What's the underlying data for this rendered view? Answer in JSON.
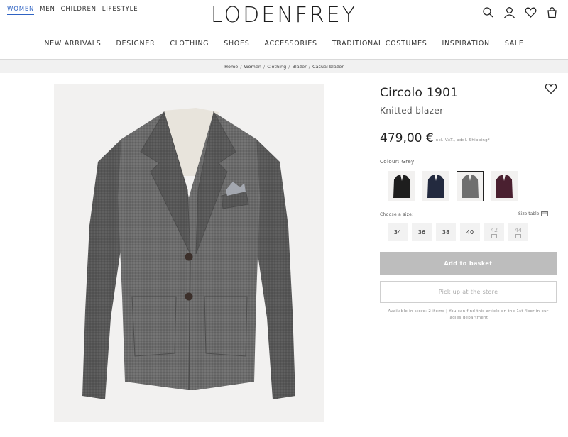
{
  "header": {
    "logo": "LODENFREY",
    "top_links": [
      "WOMEN",
      "MEN",
      "CHILDREN",
      "LIFESTYLE"
    ],
    "active_top_link": "WOMEN",
    "icons": [
      "search-icon",
      "account-icon",
      "wishlist-icon",
      "basket-icon"
    ]
  },
  "main_nav": [
    "NEW ARRIVALS",
    "DESIGNER",
    "CLOTHING",
    "SHOES",
    "ACCESSORIES",
    "TRADITIONAL COSTUMES",
    "INSPIRATION",
    "SALE"
  ],
  "breadcrumb": [
    "Home",
    "Women",
    "Clothing",
    "Blazer",
    "Casual blazer"
  ],
  "product": {
    "brand": "Circolo 1901",
    "name": "Knitted blazer",
    "price": "479,00 €",
    "price_note": "incl. VAT., addl. Shipping*",
    "colour_label": "Colour: Grey",
    "colour_swatches": [
      {
        "name": "black",
        "color": "#1e1e1e",
        "selected": false
      },
      {
        "name": "navy",
        "color": "#232a3f",
        "selected": false
      },
      {
        "name": "grey",
        "color": "#6f6f6f",
        "selected": true
      },
      {
        "name": "burgundy",
        "color": "#4a2030",
        "selected": false
      }
    ],
    "size_label": "Choose a size:",
    "size_table_label": "Size table",
    "sizes": [
      {
        "label": "34",
        "available": true
      },
      {
        "label": "36",
        "available": true
      },
      {
        "label": "38",
        "available": true
      },
      {
        "label": "40",
        "available": true
      },
      {
        "label": "42",
        "available": false
      },
      {
        "label": "44",
        "available": false
      }
    ],
    "add_to_basket": "Add to basket",
    "pickup_label": "Pick up at the store",
    "store_info": "Available in store: 2 items | You can find this article on the 1st floor in our ladies department"
  },
  "colors": {
    "accent": "#2f63c3",
    "basket_button": "#bdbdbd",
    "jacket_grey": "#6b6b6b"
  }
}
